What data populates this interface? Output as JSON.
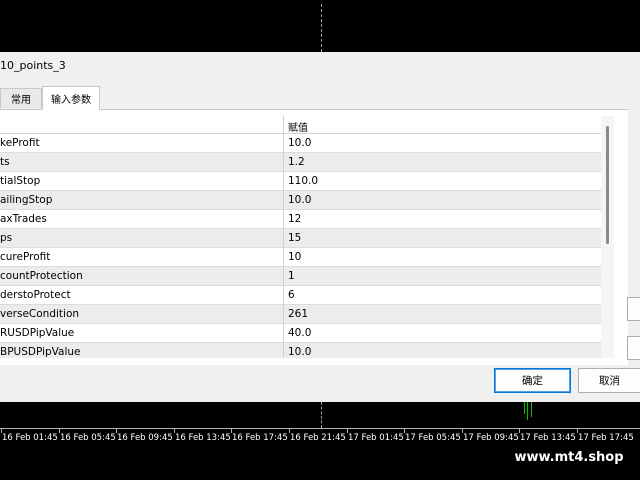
{
  "dialog": {
    "title": "10_points_3",
    "tabs": [
      {
        "label": "常用",
        "active": false
      },
      {
        "label": "输入参数",
        "active": true
      }
    ],
    "table": {
      "value_header": "赋值",
      "rows": [
        {
          "name": "keProfit",
          "value": "10.0"
        },
        {
          "name": "ts",
          "value": "1.2"
        },
        {
          "name": "tialStop",
          "value": "110.0"
        },
        {
          "name": "ailingStop",
          "value": "10.0"
        },
        {
          "name": "axTrades",
          "value": "12"
        },
        {
          "name": "ps",
          "value": "15"
        },
        {
          "name": "cureProfit",
          "value": "10"
        },
        {
          "name": "countProtection",
          "value": "1"
        },
        {
          "name": "derstoProtect",
          "value": "6"
        },
        {
          "name": "verseCondition",
          "value": "261"
        },
        {
          "name": "RUSDPipValue",
          "value": "40.0"
        },
        {
          "name": "BPUSDPipValue",
          "value": "10.0"
        }
      ]
    },
    "buttons": {
      "ok": "确定",
      "cancel": "取消"
    }
  },
  "chart": {
    "time_labels": [
      "16 Feb 01:45",
      "16 Feb 05:45",
      "16 Feb 09:45",
      "16 Feb 13:45",
      "16 Feb 17:45",
      "16 Feb 21:45",
      "17 Feb 01:45",
      "17 Feb 05:45",
      "17 Feb 09:45",
      "17 Feb 13:45",
      "17 Feb 17:45"
    ],
    "candle_color": "#00c000"
  },
  "watermark": "www.mt4.shop"
}
